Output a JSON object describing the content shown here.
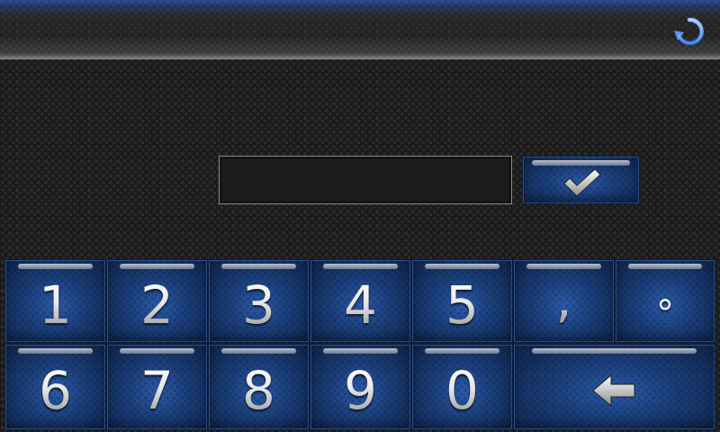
{
  "topbar": {
    "back_icon": "refresh-back-icon"
  },
  "input": {
    "value": "",
    "placeholder": ""
  },
  "confirm": {
    "icon": "checkmark-icon"
  },
  "keypad": {
    "row1": [
      "1",
      "2",
      "3",
      "4",
      "5",
      ",",
      "°"
    ],
    "row2": [
      "6",
      "7",
      "8",
      "9",
      "0"
    ],
    "backspace_icon": "backspace-arrow-icon"
  },
  "colors": {
    "accent": "#2a5aa8",
    "key_dark": "#0f2348",
    "background": "#1b1b1b"
  }
}
